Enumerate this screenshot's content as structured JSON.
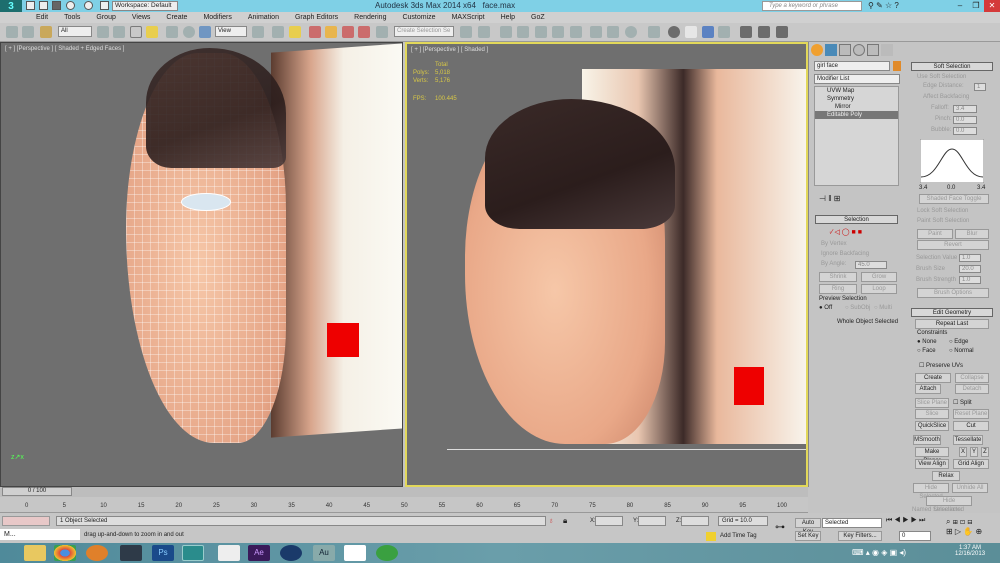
{
  "title_bar": {
    "app_title": "Autodesk 3ds Max  2014 x64",
    "file": "face.max",
    "workspace": "Workspace: Default",
    "search_placeholder": "Type a keyword or phrase",
    "minimize": "–",
    "restore": "❐",
    "close": "✕"
  },
  "menu": [
    "Edit",
    "Tools",
    "Group",
    "Views",
    "Create",
    "Modifiers",
    "Animation",
    "Graph Editors",
    "Rendering",
    "Customize",
    "MAXScript",
    "Help",
    "GoZ"
  ],
  "toolbar": {
    "filter": "All",
    "ref_coord": "View",
    "named_selection_placeholder": "Create Selection Se"
  },
  "viewports": {
    "left": {
      "label": "[ + ] [Perspective ] [ Shaded + Edged Faces ]"
    },
    "right": {
      "label": "[ + ] [Perspective ] [ Shaded ]",
      "stats": {
        "total_label": "Total",
        "polys_label": "Polys:",
        "polys": "5,018",
        "verts_label": "Verts:",
        "verts": "5,176",
        "fps_label": "FPS:",
        "fps": "100.445"
      }
    }
  },
  "command_panel": {
    "object_name": "girl face",
    "object_color": "#e08a2a",
    "modifier_list": "Modifier List",
    "stack": [
      {
        "label": "UVW Map"
      },
      {
        "label": "Symmetry"
      },
      {
        "label": "Mirror"
      },
      {
        "label": "Editable Poly"
      }
    ],
    "selection": {
      "title": "Selection",
      "by_vertex": "By Vertex",
      "ignore_backfacing": "Ignore Backfacing",
      "by_angle": "By Angle:",
      "angle": "45.0",
      "shrink": "Shrink",
      "grow": "Grow",
      "ring": "Ring",
      "loop": "Loop",
      "preview_title": "Preview Selection",
      "off": "Off",
      "subobj": "SubObj",
      "multi": "Multi",
      "status": "Whole Object Selected"
    },
    "soft_selection": {
      "title": "Soft Selection",
      "use_soft": "Use Soft Selection",
      "edge_distance": "Edge Distance:",
      "edge_val": "1",
      "affect_backfacing": "Affect Backfacing",
      "falloff": "Falloff:",
      "falloff_val": "3.4",
      "pinch": "Pinch:",
      "pinch_val": "0.0",
      "bubble": "Bubble:",
      "bubble_val": "0.0",
      "curve_left": "3.4",
      "curve_mid": "0.0",
      "curve_right": "3.4",
      "shaded_face_toggle": "Shaded Face Toggle",
      "lock": "Lock Soft Selection",
      "paint_group": "Paint Soft Selection",
      "paint": "Paint",
      "blur": "Blur",
      "revert": "Revert",
      "sel_value": "Selection Value",
      "sel_value_val": "1.0",
      "brush_size": "Brush Size",
      "brush_size_val": "20.0",
      "brush_strength": "Brush Strength",
      "brush_strength_val": "1.0",
      "brush_options": "Brush Options"
    },
    "edit_geometry": {
      "title": "Edit Geometry",
      "repeat_last": "Repeat Last",
      "constraints": "Constraints",
      "none": "None",
      "edge": "Edge",
      "face": "Face",
      "normal": "Normal",
      "preserve_uvs": "Preserve UVs",
      "create": "Create",
      "collapse": "Collapse",
      "attach": "Attach",
      "detach": "Detach",
      "slice_plane": "Slice Plane",
      "split": "Split",
      "slice": "Slice",
      "reset_plane": "Reset Plane",
      "quickslice": "QuickSlice",
      "cut": "Cut",
      "msmooth": "MSmooth",
      "tessellate": "Tessellate",
      "make_planar": "Make Planar",
      "x": "X",
      "y": "Y",
      "z": "Z",
      "view_align": "View Align",
      "grid_align": "Grid Align",
      "relax": "Relax",
      "hide_selected": "Hide Selected",
      "unhide_all": "Unhide All",
      "hide_unselected": "Hide Unselected",
      "named_selections": "Named Selections:"
    }
  },
  "timeline": {
    "frame": "0 / 100",
    "ticks": [
      "0",
      "5",
      "10",
      "15",
      "20",
      "25",
      "30",
      "35",
      "40",
      "45",
      "50",
      "55",
      "60",
      "65",
      "70",
      "75",
      "80",
      "85",
      "90",
      "95",
      "100"
    ]
  },
  "status": {
    "selected": "1 Object Selected",
    "prompt": "drag up-and-down to zoom in and out",
    "x_label": "X:",
    "y_label": "Y:",
    "z_label": "Z:",
    "grid": "Grid = 10.0",
    "add_time_tag": "Add Time Tag",
    "auto_key": "Auto Key",
    "set_key": "Set Key",
    "key_mode": "Selected",
    "key_filters": "Key Filters...",
    "current_frame": "0",
    "mini_listener": "M..."
  },
  "taskbar": {
    "time": "1:37 AM",
    "date": "12/16/2013",
    "apps": [
      "explorer",
      "chrome",
      "firefox",
      "app",
      "photoshop",
      "3dsmax",
      "zbrush",
      "after-effects",
      "app2",
      "audition",
      "app3",
      "utorrent"
    ]
  }
}
